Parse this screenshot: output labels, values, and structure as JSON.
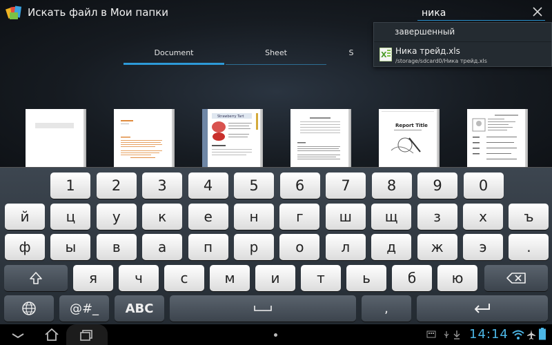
{
  "app": {
    "title": "Искать файл в Мои папки",
    "search_value": "ника"
  },
  "tabs": [
    {
      "label": "Document",
      "active": true
    },
    {
      "label": "Sheet",
      "active": false
    },
    {
      "label": "S",
      "active": false
    }
  ],
  "suggestions": {
    "item1": "завершенный",
    "item2_name": "Ника трейд.xls",
    "item2_path": "/storage/sdcard0/Ника трейд.xls"
  },
  "thumbnails": [
    {
      "name": "thumb-blank-document"
    },
    {
      "name": "thumb-orange-document"
    },
    {
      "name": "thumb-recipe-document",
      "title": "Strawberry Tart"
    },
    {
      "name": "thumb-form-document"
    },
    {
      "name": "thumb-report-document",
      "title": "Report Title"
    },
    {
      "name": "thumb-resume-document"
    }
  ],
  "keyboard": {
    "row1": [
      "1",
      "2",
      "3",
      "4",
      "5",
      "6",
      "7",
      "8",
      "9",
      "0"
    ],
    "row2": [
      "й",
      "ц",
      "у",
      "к",
      "е",
      "н",
      "г",
      "ш",
      "щ",
      "з",
      "х",
      "ъ"
    ],
    "row3": [
      "ф",
      "ы",
      "в",
      "а",
      "п",
      "р",
      "о",
      "л",
      "д",
      "ж",
      "э",
      "."
    ],
    "row4": [
      "я",
      "ч",
      "с",
      "м",
      "и",
      "т",
      "ь",
      "б",
      "ю"
    ],
    "symbols_label": "@#_",
    "abc_label": "ABC",
    "comma_label": ","
  },
  "status": {
    "time": "14:14"
  },
  "colors": {
    "accent": "#2d9ad8",
    "clock": "#4cb6e6"
  }
}
